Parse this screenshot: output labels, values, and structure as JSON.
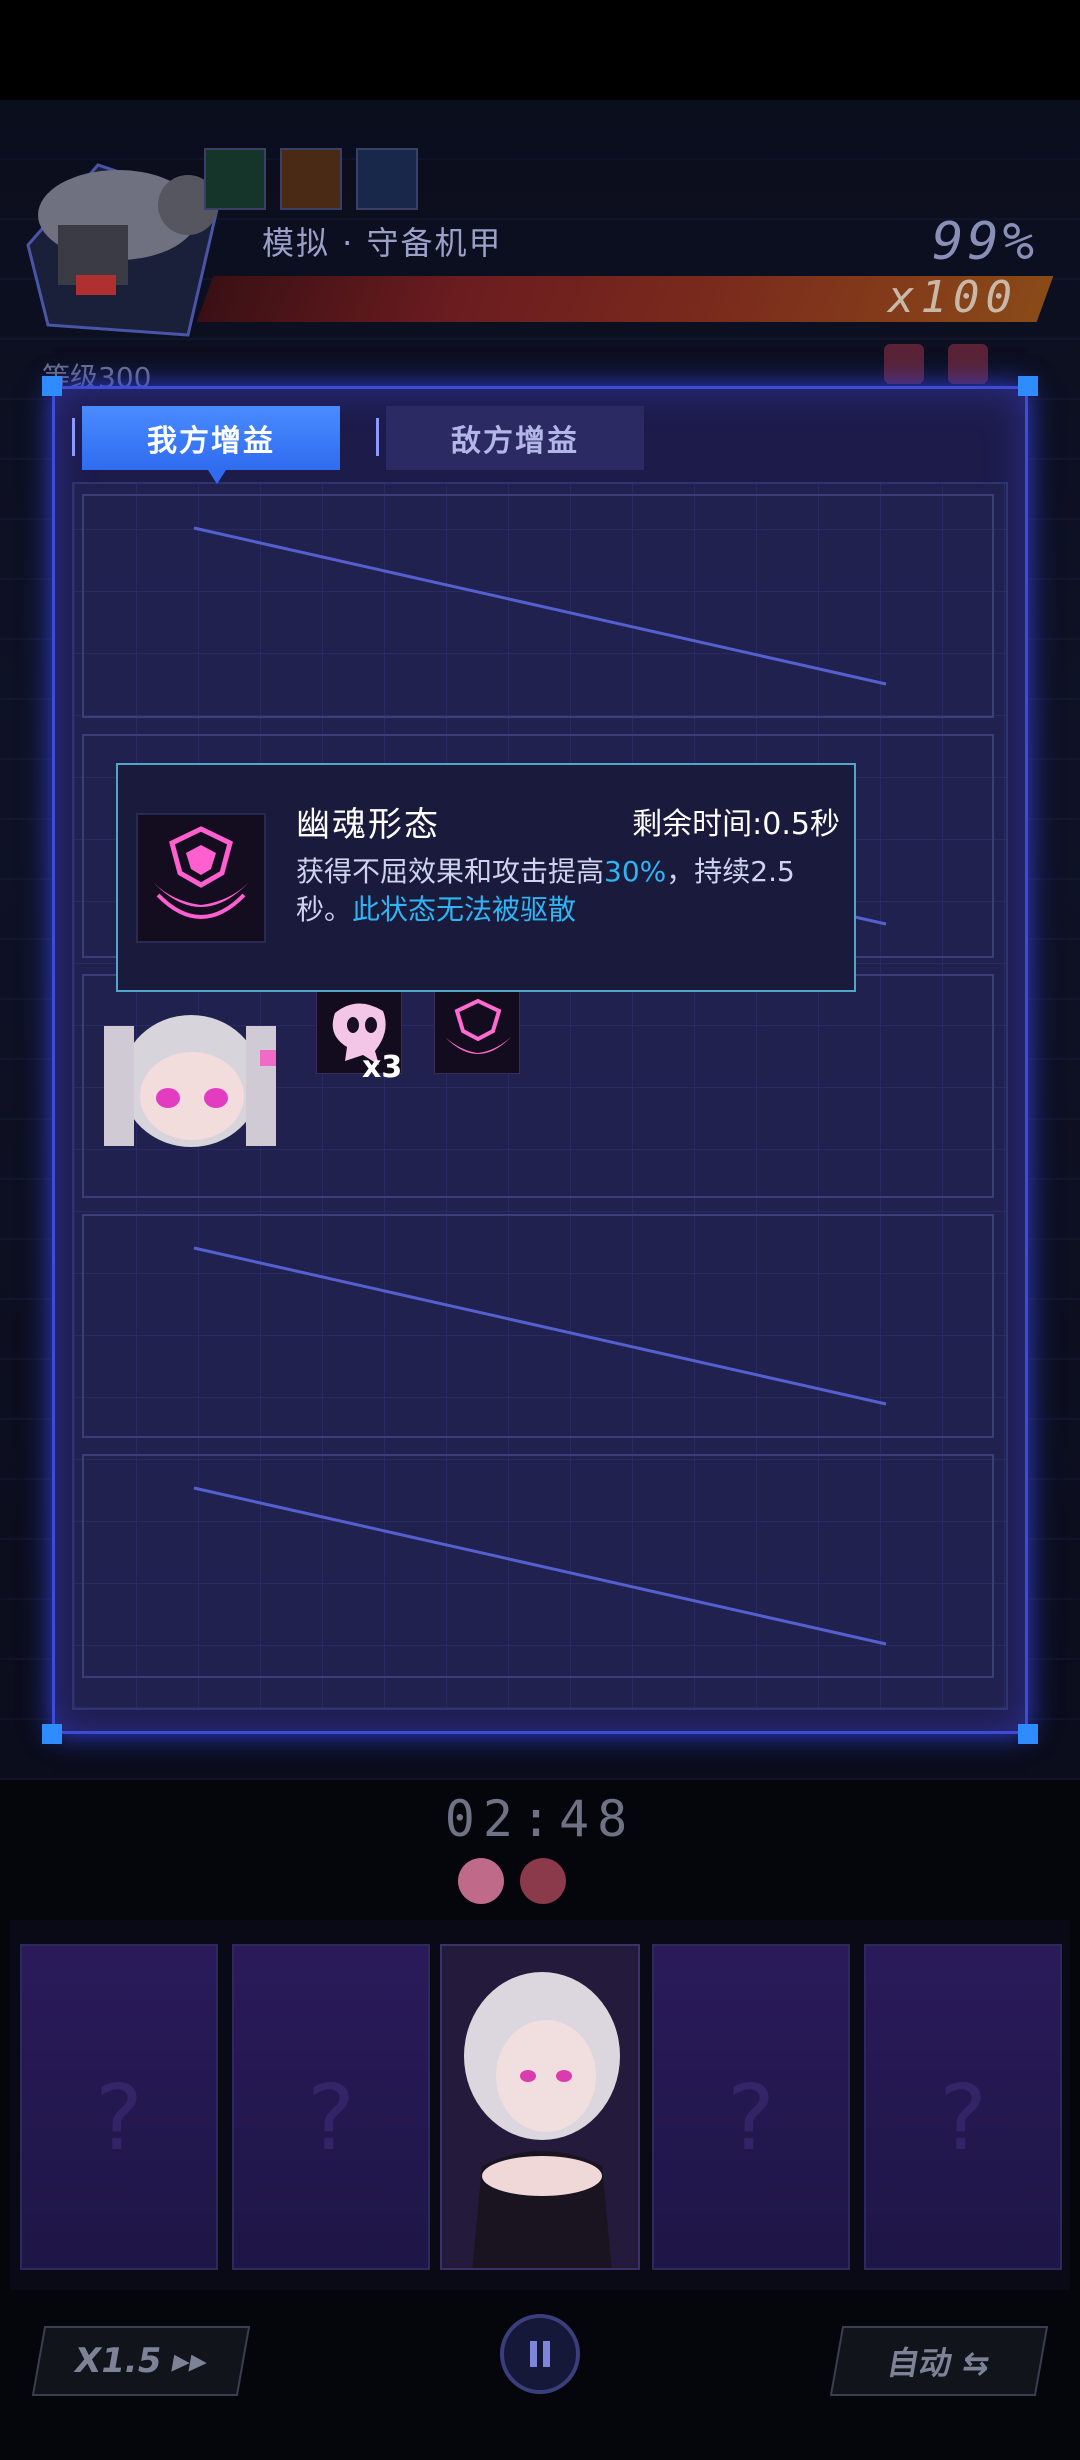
{
  "boss": {
    "name": "模拟 · 守备机甲",
    "hp_percent": "99%",
    "hp_bars": "x100",
    "level": "等级300",
    "skill_icons": [
      "green-slash-icon",
      "fire-burst-icon",
      "blue-lightning-icon"
    ]
  },
  "panel": {
    "tabs": [
      {
        "label": "我方增益",
        "active": true
      },
      {
        "label": "敌方增益",
        "active": false
      }
    ]
  },
  "tooltip": {
    "name": "幽魂形态",
    "remaining": "剩余时间:0.5秒",
    "desc_part1": "获得不屈效果和攻击提高",
    "desc_highlight": "30%",
    "desc_part2": "，持续2.5秒。",
    "desc_note": "此状态无法被驱散",
    "icon": "winged-shield-icon"
  },
  "character_buffs": {
    "items": [
      {
        "icon": "ghost-icon",
        "count": "x3"
      },
      {
        "icon": "winged-shield-icon",
        "count": ""
      }
    ]
  },
  "hud": {
    "timer": "02:48",
    "speed_label": "X1.5 ▸▸",
    "auto_label": "自动 ⇆",
    "colors": {
      "accent": "#3d4bd6",
      "highlight": "#2fb4f4",
      "active_tab": "#4a8bff"
    }
  }
}
